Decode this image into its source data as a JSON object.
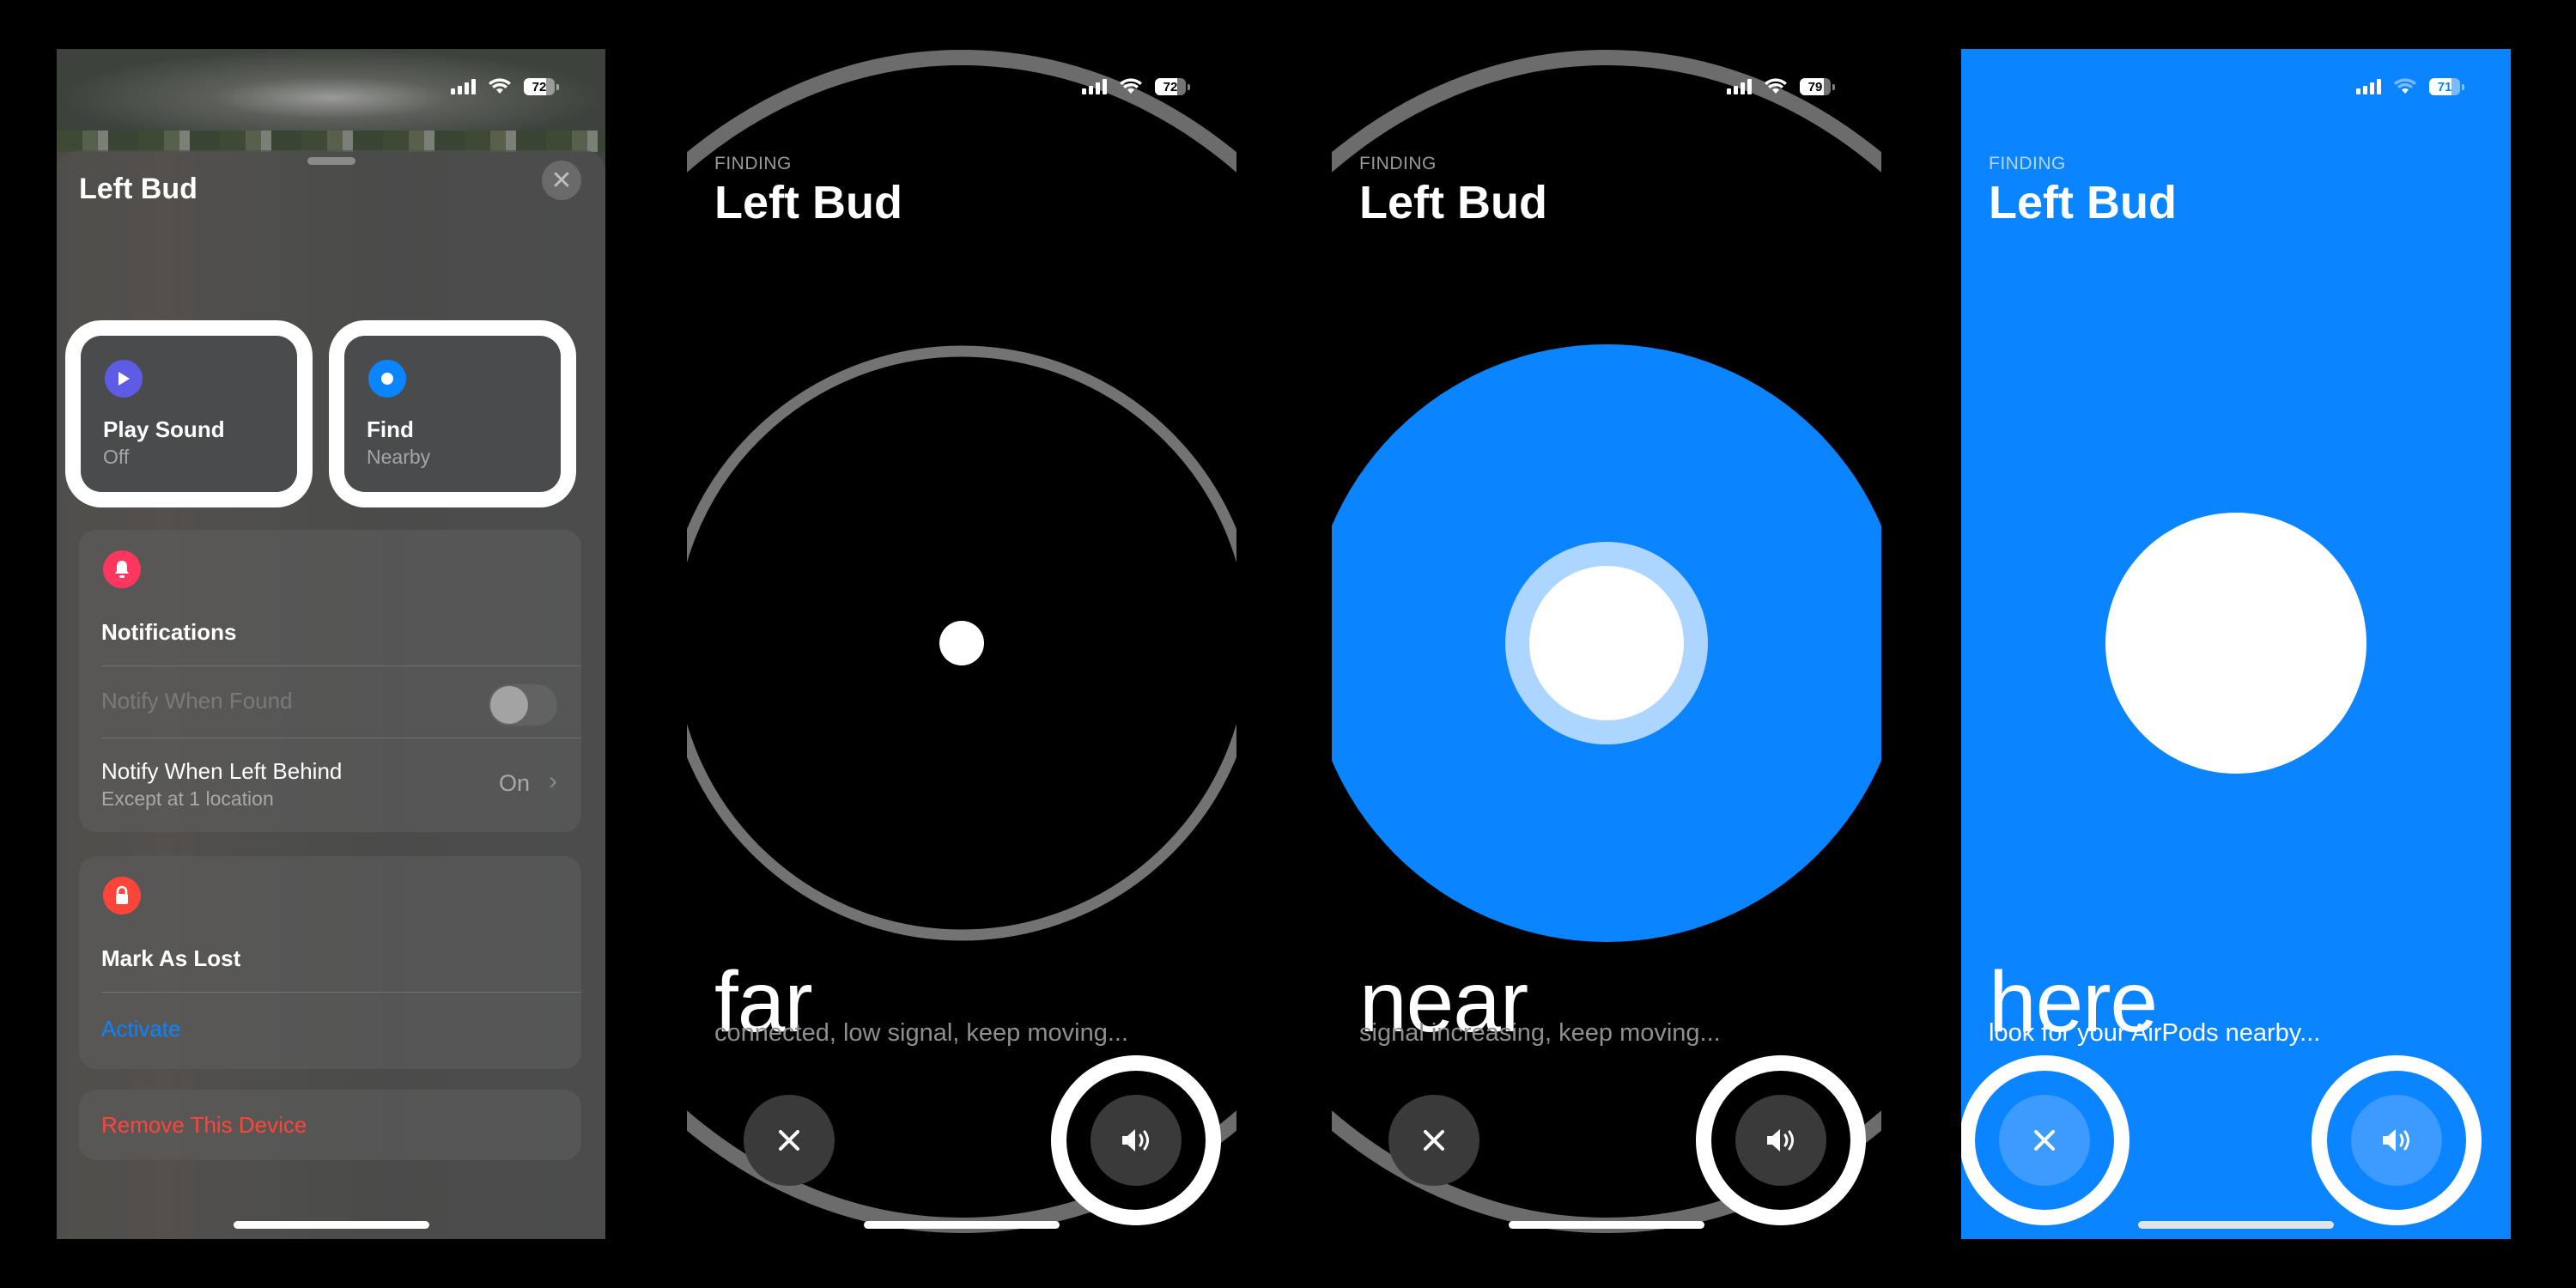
{
  "panels": [
    {
      "id": "device-sheet",
      "status_bar": {
        "battery": "72"
      },
      "title": "Left Bud",
      "actions": [
        {
          "label": "Play Sound",
          "sublabel": "Off",
          "icon": "play-icon",
          "color": "#5e5ce6"
        },
        {
          "label": "Find",
          "sublabel": "Nearby",
          "icon": "find-nearby-icon",
          "color": "#0a84ff"
        }
      ],
      "notifications": {
        "header": "Notifications",
        "icon_color": "#ff375f",
        "notify_when_found": {
          "label": "Notify When Found",
          "enabled": false,
          "disabled": true
        },
        "notify_left_behind": {
          "label": "Notify When Left Behind",
          "sublabel": "Except at 1 location",
          "value": "On"
        }
      },
      "lost_mode": {
        "header": "Mark As Lost",
        "icon_color": "#ff453a",
        "action": "Activate",
        "action_color": "#0a84ff"
      },
      "remove": {
        "label": "Remove This Device",
        "color": "#ff453a"
      }
    },
    {
      "id": "finding-far",
      "status_bar": {
        "battery": "72"
      },
      "eyebrow": "FINDING",
      "title": "Left Bud",
      "proximity": "far",
      "hint": "connected, low signal, keep moving...",
      "buttons": {
        "close": "close-icon",
        "sound": "speaker-icon"
      }
    },
    {
      "id": "finding-near",
      "status_bar": {
        "battery": "79"
      },
      "eyebrow": "FINDING",
      "title": "Left Bud",
      "proximity": "near",
      "hint": "signal increasing, keep moving...",
      "accent": "#0a84ff",
      "buttons": {
        "close": "close-icon",
        "sound": "speaker-icon"
      }
    },
    {
      "id": "finding-here",
      "status_bar": {
        "battery": "71"
      },
      "eyebrow": "FINDING",
      "title": "Left Bud",
      "proximity": "here",
      "hint": "look for your AirPods nearby...",
      "background": "#0a84ff",
      "buttons": {
        "close": "close-icon",
        "sound": "speaker-icon"
      }
    }
  ]
}
